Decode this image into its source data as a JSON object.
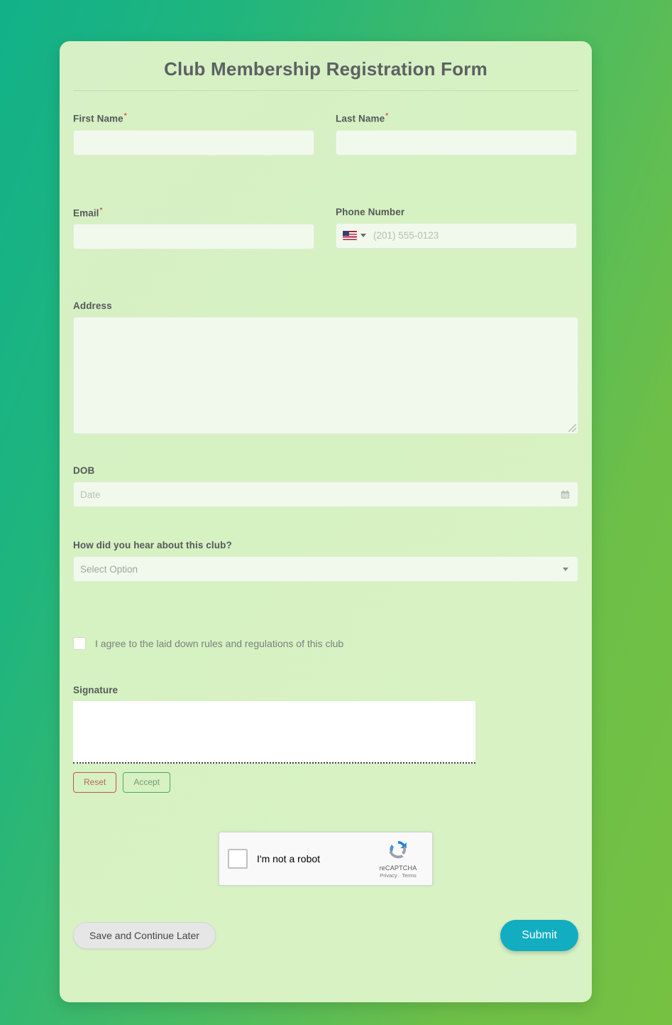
{
  "form": {
    "title": "Club Membership Registration Form",
    "fields": {
      "first_name": {
        "label": "First Name",
        "required_mark": "*",
        "value": "",
        "placeholder": ""
      },
      "last_name": {
        "label": "Last Name",
        "required_mark": "*",
        "value": "",
        "placeholder": ""
      },
      "email": {
        "label": "Email",
        "required_mark": "*",
        "value": "",
        "placeholder": ""
      },
      "phone": {
        "label": "Phone Number",
        "value": "",
        "placeholder": "(201) 555-0123",
        "country_flag": "us-flag-icon"
      },
      "address": {
        "label": "Address",
        "value": "",
        "placeholder": ""
      },
      "dob": {
        "label": "DOB",
        "value": "",
        "placeholder": "Date",
        "icon": "calendar-icon"
      },
      "referral": {
        "label": "How did you hear about this club?",
        "selected": "Select Option"
      },
      "agreement": {
        "label": "I agree to the laid down rules and regulations of this club",
        "checked": false
      },
      "signature": {
        "label": "Signature",
        "reset_label": "Reset",
        "accept_label": "Accept"
      }
    }
  },
  "recaptcha": {
    "label": "I'm not a robot",
    "brand": "reCAPTCHA",
    "privacy": "Privacy",
    "separator": "·",
    "terms": "Terms",
    "checked": false
  },
  "footer": {
    "save_label": "Save and Continue Later",
    "submit_label": "Submit"
  },
  "colors": {
    "accent_submit": "#12adc1",
    "card_bg": "#d7f0c5",
    "input_bg": "#f1f9ec",
    "required": "#d9534f",
    "reset_border": "#c0554a",
    "accept_border": "#4cab5c",
    "bg_gradient_start": "#12b189",
    "bg_gradient_end": "#76c142"
  }
}
